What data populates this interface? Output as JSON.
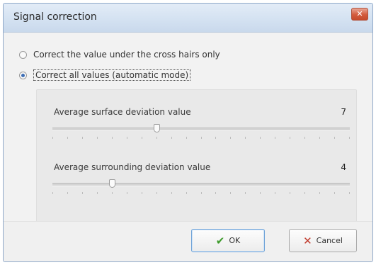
{
  "window": {
    "title": "Signal correction",
    "close_glyph": "✕"
  },
  "options": [
    {
      "label": "Correct the value under the cross hairs only",
      "checked": false
    },
    {
      "label": "Correct all values (automatic mode)",
      "checked": true
    }
  ],
  "sliders": [
    {
      "label": "Average surface deviation value",
      "value": "7",
      "level": 0.35
    },
    {
      "label": "Average surrounding deviation value",
      "value": "4",
      "level": 0.2
    }
  ],
  "buttons": {
    "ok_label": "OK",
    "ok_icon": "checkmark-icon",
    "ok_glyph": "✔",
    "cancel_label": "Cancel",
    "cancel_icon": "cross-icon",
    "cancel_glyph": "✕"
  }
}
